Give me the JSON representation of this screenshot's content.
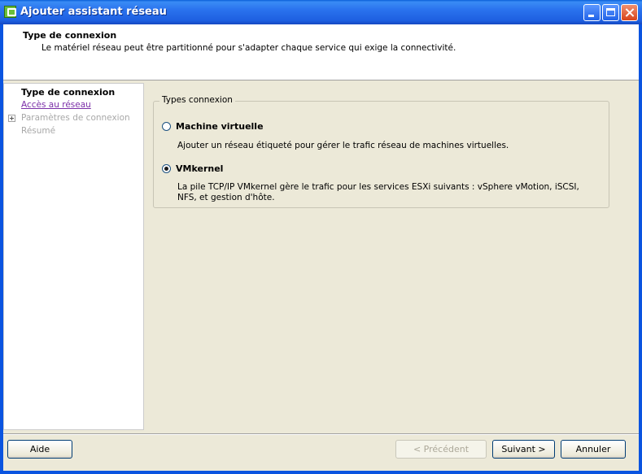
{
  "window": {
    "title": "Ajouter assistant réseau",
    "icon": "vsphere-network-icon"
  },
  "header": {
    "title": "Type de connexion",
    "description": "Le matériel réseau peut être partitionné pour s'adapter chaque service qui exige la connectivité."
  },
  "nav": {
    "items": [
      {
        "label": "Type de connexion",
        "state": "current"
      },
      {
        "label": "Accès au réseau",
        "state": "link"
      },
      {
        "label": "Paramètres de connexion",
        "state": "disabled"
      },
      {
        "label": "Résumé",
        "state": "disabled"
      }
    ]
  },
  "connection_types": {
    "legend": "Types connexion",
    "options": [
      {
        "label": "Machine virtuelle",
        "description": "Ajouter un réseau étiqueté pour gérer le trafic réseau de machines virtuelles.",
        "selected": false
      },
      {
        "label": "VMkernel",
        "description": "La pile TCP/IP VMkernel gère le trafic pour les services ESXi suivants : vSphere vMotion, iSCSI, NFS, et gestion d'hôte.",
        "selected": true
      }
    ]
  },
  "footer": {
    "help": "Aide",
    "previous": "< Précédent",
    "next": "Suivant >",
    "cancel": "Annuler"
  }
}
